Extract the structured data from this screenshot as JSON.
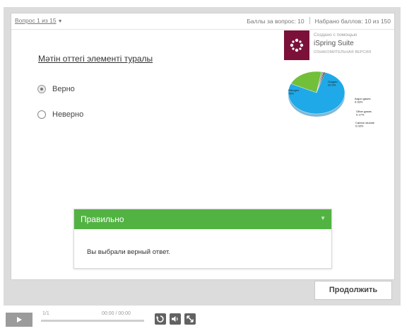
{
  "topbar": {
    "question_nav": "Вопрос 1 из 15",
    "points_per_question": "Баллы за вопрос: 10",
    "points_total": "Набрано баллов: 10 из 150"
  },
  "watermark": {
    "line1": "Создано с помощью",
    "line2": "iSpring Suite",
    "line3": "ОЗНАКОМИТЕЛЬНАЯ ВЕРСИЯ",
    "brand_color": "#7b1138"
  },
  "question": {
    "title": "Мәтін оттегі элементі туралы",
    "answers": [
      {
        "label": "Верно",
        "selected": true
      },
      {
        "label": "Неверно",
        "selected": false
      }
    ]
  },
  "chart_data": {
    "type": "pie",
    "slices": [
      {
        "label": "Nitrogen",
        "value": 78
      },
      {
        "label": "Oxygen",
        "value": 20.9
      },
      {
        "label": "Argon gases",
        "value": 0.93
      },
      {
        "label": "Other gases",
        "value": 0.17
      },
      {
        "label": "Carbon dioxide",
        "value": 0.03
      }
    ],
    "label_texts": {
      "nitrogen": "Nitrogen 78%",
      "oxygen": "Oxygen 20.9%",
      "argon": "Argon gases 0.93%",
      "other": "Other gases 0.17%",
      "co2": "Carbon dioxide 0.03%"
    },
    "colors": [
      "#1fa9e8",
      "#72bf3a",
      "#9a9a9a",
      "#5d5d5d",
      "#333333"
    ]
  },
  "feedback": {
    "title": "Правильно",
    "message": "Вы выбрали верный ответ.",
    "color": "#52b343"
  },
  "continue_label": "Продолжить",
  "controls": {
    "slide_count": "1/1",
    "time": "00:00 / 00:00"
  }
}
